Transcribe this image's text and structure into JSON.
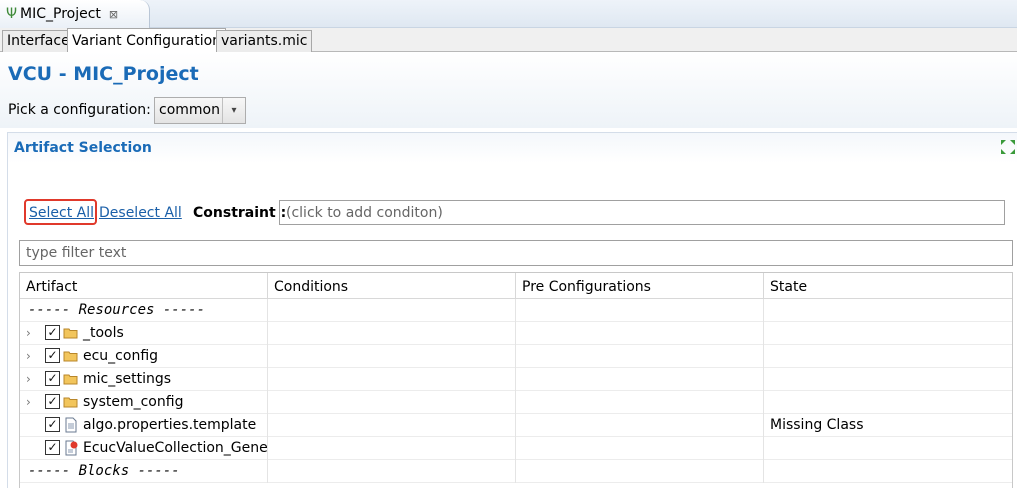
{
  "editor_tab": {
    "title": "MIC_Project",
    "close_glyph": "⊠",
    "icon": "project-icon"
  },
  "page_tabs": [
    {
      "label": "Interface",
      "active": false
    },
    {
      "label": "Variant Configuration",
      "active": true
    },
    {
      "label": "variants.mic",
      "active": false
    }
  ],
  "header": {
    "title": "VCU - MIC_Project",
    "config_label": "Pick a configuration:",
    "config_value": "common"
  },
  "section": {
    "title": "Artifact Selection",
    "select_all": "Select All",
    "deselect_all": "Deselect All",
    "constraint_label": "Constraint :",
    "constraint_placeholder": "(click to add conditon)",
    "filter_placeholder": "type filter text"
  },
  "table": {
    "columns": [
      "Artifact",
      "Conditions",
      "Pre Configurations",
      "State"
    ],
    "rows": [
      {
        "kind": "separator",
        "label": "----- Resources -----"
      },
      {
        "kind": "folder",
        "label": "_tools",
        "checked": true,
        "expandable": true,
        "state": ""
      },
      {
        "kind": "folder",
        "label": "ecu_config",
        "checked": true,
        "expandable": true,
        "state": ""
      },
      {
        "kind": "folder",
        "label": "mic_settings",
        "checked": true,
        "expandable": true,
        "state": ""
      },
      {
        "kind": "folder",
        "label": "system_config",
        "checked": true,
        "expandable": true,
        "state": ""
      },
      {
        "kind": "file",
        "label": "algo.properties.template",
        "checked": true,
        "expandable": false,
        "state": "Missing Class"
      },
      {
        "kind": "file-error",
        "label": "EcucValueCollection_Genera",
        "checked": true,
        "expandable": false,
        "state": ""
      },
      {
        "kind": "separator",
        "label": "----- Blocks -----"
      }
    ]
  },
  "colors": {
    "accent": "#1a6bb7",
    "link": "#1a5fa8",
    "highlight": "#e0392b",
    "folder": "#e8b64c"
  }
}
